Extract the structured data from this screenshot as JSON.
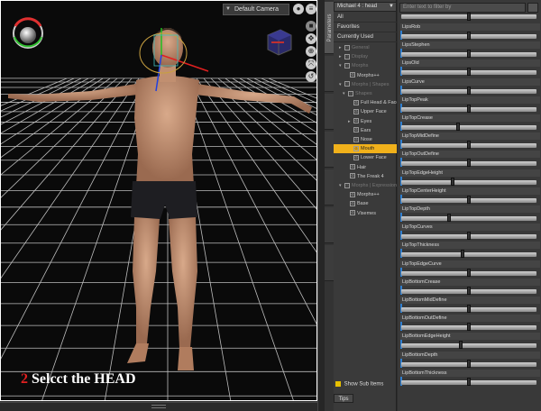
{
  "viewport": {
    "camera": "Default Camera",
    "caption_number": "2",
    "caption_text": "Selcct the HEAD"
  },
  "figure_selector": "Michael 4 : head",
  "tree": {
    "top_items": [
      "All",
      "Favorites",
      "Currently Used"
    ],
    "items": [
      {
        "label": "General",
        "dim": true
      },
      {
        "label": "Display",
        "dim": true
      },
      {
        "label": "Morphs",
        "dim": true
      },
      {
        "label": "Morphs++",
        "dim": false
      },
      {
        "label": "Morphs | Shapes",
        "dim": true
      },
      {
        "label": "Shapes",
        "dim": true
      },
      {
        "label": "Full Head & Face",
        "dim": false
      },
      {
        "label": "Upper Face",
        "dim": false
      },
      {
        "label": "Eyes",
        "dim": false
      },
      {
        "label": "Ears",
        "dim": false
      },
      {
        "label": "Nose",
        "dim": false
      },
      {
        "label": "Mouth",
        "dim": false,
        "selected": true
      },
      {
        "label": "Lower Face",
        "dim": false
      },
      {
        "label": "Hair",
        "dim": false
      },
      {
        "label": "The Freak 4",
        "dim": false
      },
      {
        "label": "Morphs | Expressions",
        "dim": true
      },
      {
        "label": "Morphs++",
        "dim": false
      },
      {
        "label": "Base",
        "dim": false
      },
      {
        "label": "Visemes",
        "dim": false
      }
    ],
    "show_sub_items": "Show Sub Items",
    "tips_tab": "Tips"
  },
  "vertical_tabs": [
    "Parameters"
  ],
  "filter_placeholder": "Enter text to filter by",
  "parameters": [
    {
      "name": "LipsRob",
      "value": 0.5
    },
    {
      "name": "LipsStephen",
      "value": 0.5
    },
    {
      "name": "LipsOld",
      "value": 0.5
    },
    {
      "name": "LipsCurve",
      "value": 0.5
    },
    {
      "name": "LipTopPeak",
      "value": 0.5
    },
    {
      "name": "LipTopCrease",
      "value": 0.42
    },
    {
      "name": "LipTopMidDefine",
      "value": 0.5
    },
    {
      "name": "LipTopOutDefine",
      "value": 0.5
    },
    {
      "name": "LipTopEdgeHeight",
      "value": 0.38
    },
    {
      "name": "LipTopCenterHeight",
      "value": 0.5
    },
    {
      "name": "LipTopDepth",
      "value": 0.35
    },
    {
      "name": "LipTopCurves",
      "value": 0.5
    },
    {
      "name": "LipTopThickness",
      "value": 0.45
    },
    {
      "name": "LipTopEdgeCurve",
      "value": 0.5
    },
    {
      "name": "LipBottomCrease",
      "value": 0.5
    },
    {
      "name": "LipBottomMidDefine",
      "value": 0.5
    },
    {
      "name": "LipBottomOutDefine",
      "value": 0.5
    },
    {
      "name": "LipBottomEdgeHeight",
      "value": 0.44
    },
    {
      "name": "LipBottomDepth",
      "value": 0.5
    },
    {
      "name": "LipBottomThickness",
      "value": 0.5
    }
  ]
}
